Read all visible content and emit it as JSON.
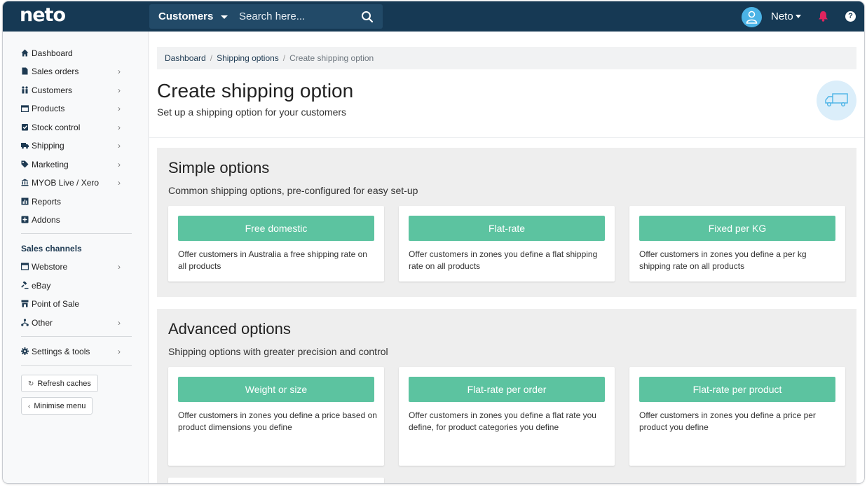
{
  "header": {
    "logo": "neto",
    "search_scope": "Customers",
    "search_placeholder": "Search here...",
    "user_name": "Neto",
    "help_glyph": "?",
    "colors": {
      "topbar": "#163954",
      "accent_green": "#5cc3a0",
      "alert": "#e0245e"
    }
  },
  "sidebar": {
    "items": [
      {
        "label": "Dashboard",
        "icon": "home-icon",
        "has_children": false
      },
      {
        "label": "Sales orders",
        "icon": "document-icon",
        "has_children": true
      },
      {
        "label": "Customers",
        "icon": "people-icon",
        "has_children": true
      },
      {
        "label": "Products",
        "icon": "box-icon",
        "has_children": true
      },
      {
        "label": "Stock control",
        "icon": "clipboard-check-icon",
        "has_children": true
      },
      {
        "label": "Shipping",
        "icon": "truck-icon",
        "has_children": true
      },
      {
        "label": "Marketing",
        "icon": "tag-icon",
        "has_children": true
      },
      {
        "label": "MYOB Live / Xero",
        "icon": "bank-icon",
        "has_children": true
      },
      {
        "label": "Reports",
        "icon": "bar-chart-icon",
        "has_children": false
      },
      {
        "label": "Addons",
        "icon": "plus-square-icon",
        "has_children": false
      }
    ],
    "channels_heading": "Sales channels",
    "channels": [
      {
        "label": "Webstore",
        "icon": "browser-icon",
        "has_children": true
      },
      {
        "label": "eBay",
        "icon": "gavel-icon",
        "has_children": false
      },
      {
        "label": "Point of Sale",
        "icon": "store-icon",
        "has_children": false
      },
      {
        "label": "Other",
        "icon": "network-icon",
        "has_children": true
      }
    ],
    "settings": {
      "label": "Settings & tools",
      "icon": "gear-icon",
      "has_children": true
    },
    "refresh_label": "Refresh caches",
    "minimise_label": "Minimise menu"
  },
  "breadcrumb": {
    "items": [
      "Dashboard",
      "Shipping options"
    ],
    "current": "Create shipping option"
  },
  "page": {
    "title": "Create shipping option",
    "subtitle": "Set up a shipping option for your customers"
  },
  "sections": [
    {
      "title": "Simple options",
      "subtitle": "Common shipping options, pre-configured for easy set-up",
      "cards": [
        {
          "button": "Free domestic",
          "description": "Offer customers in Australia a free shipping rate on all products"
        },
        {
          "button": "Flat-rate",
          "description": "Offer customers in zones you define a flat shipping rate on all products"
        },
        {
          "button": "Fixed per KG",
          "description": "Offer customers in zones you define a per kg shipping rate on all products"
        }
      ]
    },
    {
      "title": "Advanced options",
      "subtitle": "Shipping options with greater precision and control",
      "cards": [
        {
          "button": "Weight or size",
          "description": "Offer customers in zones you define a price based on product dimensions you define"
        },
        {
          "button": "Flat-rate per order",
          "description": "Offer customers in zones you define a flat rate you define, for product categories you define"
        },
        {
          "button": "Flat-rate per product",
          "description": "Offer customers in zones you define a price per product you define"
        }
      ]
    }
  ]
}
